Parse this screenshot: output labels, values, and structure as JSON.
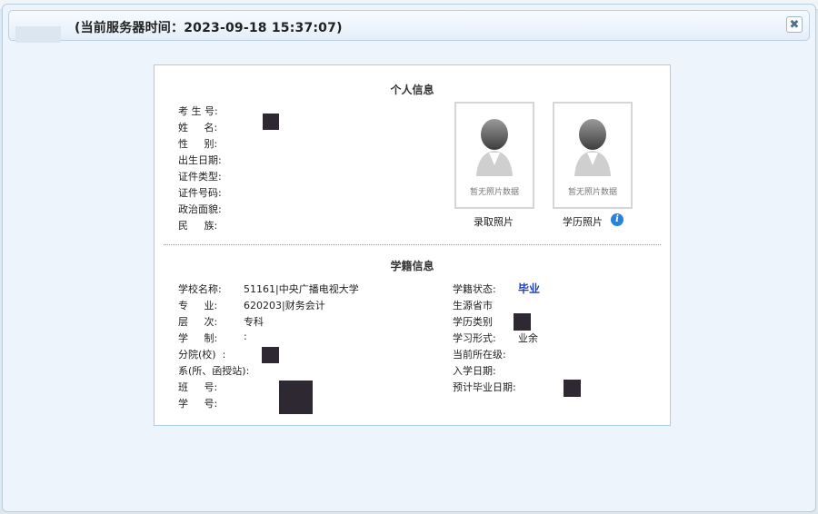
{
  "header": {
    "server_time": "(当前服务器时间：2023-09-18 15:37:07)",
    "close_icon": "close-icon"
  },
  "personal": {
    "title": "个人信息",
    "fields": [
      {
        "label": "考 生 号:",
        "value": ""
      },
      {
        "label": "姓     名:",
        "value": ""
      },
      {
        "label": "性     别:",
        "value": ""
      },
      {
        "label": "出生日期:",
        "value": ""
      },
      {
        "label": "证件类型:",
        "value": ""
      },
      {
        "label": "证件号码:",
        "value": ""
      },
      {
        "label": "政治面貌:",
        "value": ""
      },
      {
        "label": "民     族:",
        "value": ""
      }
    ],
    "photos": [
      {
        "no_data": "暂无照片数据",
        "caption": "录取照片"
      },
      {
        "no_data": "暂无照片数据",
        "caption": "学历照片"
      }
    ]
  },
  "academic": {
    "title": "学籍信息",
    "left": [
      {
        "label": "学校名称:",
        "value": "51161|中央广播电视大学"
      },
      {
        "label": "专     业:",
        "value": "620203|财务会计"
      },
      {
        "label": "层     次:",
        "value": "专科"
      },
      {
        "label": "学     制:",
        "value": ":"
      },
      {
        "label": "分院(校)  :",
        "value": ""
      },
      {
        "label": "系(所、函授站):",
        "value": ""
      },
      {
        "label": "班     号:",
        "value": ""
      },
      {
        "label": "学     号:",
        "value": ""
      }
    ],
    "right": [
      {
        "label": "学籍状态:",
        "value": "毕业"
      },
      {
        "label": "生源省市",
        "value": ""
      },
      {
        "label": "学历类别",
        "value": ""
      },
      {
        "label": "学习形式:",
        "value": "业余"
      },
      {
        "label": "当前所在级:",
        "value": ""
      },
      {
        "label": "入学日期:",
        "value": ""
      },
      {
        "label": "预计毕业日期:",
        "value": ""
      }
    ]
  }
}
